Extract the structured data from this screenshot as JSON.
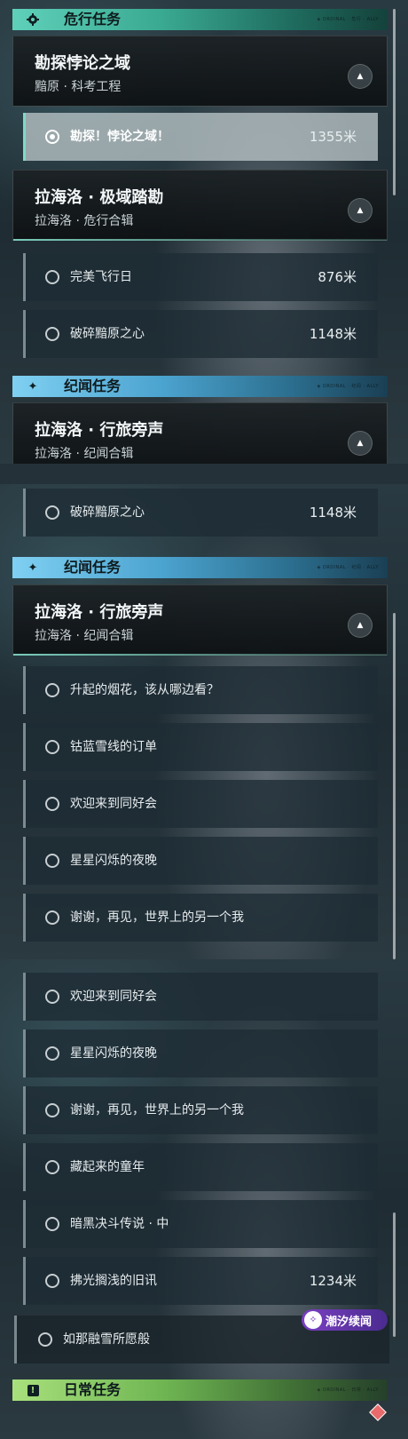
{
  "categories": {
    "danger": {
      "title": "危行任务",
      "icon": "gear-icon",
      "deco": "◈ ORDINAL · 危行 · ALLY"
    },
    "lore": {
      "title": "纪闻任务",
      "icon": "sparkle-icon",
      "deco": "◈ ORDINAL · 纪闻 · ALLY"
    },
    "daily": {
      "title": "日常任务",
      "icon": "exclamation-icon",
      "icon_glyph": "!",
      "deco": "◈ ORDINAL · 日常 · ALLY"
    }
  },
  "groups": {
    "paradox": {
      "title": "勘探悖论之域",
      "subtitle": "黯原 · 科考工程"
    },
    "lahailuo_danger": {
      "title": "拉海洛 · 极域踏勘",
      "subtitle": "拉海洛 · 危行合辑"
    },
    "lahailuo_lore": {
      "title": "拉海洛 · 行旅旁声",
      "subtitle": "拉海洛 · 纪闻合辑"
    }
  },
  "quests": {
    "explore_paradox": {
      "name": "勘探！悖论之域！",
      "distance": "1355米",
      "active": true
    },
    "perfect_flight": {
      "name": "完美飞行日",
      "distance": "876米"
    },
    "shatter_heart": {
      "name": "破碎黯原之心",
      "distance": "1148米"
    },
    "fireworks": {
      "name": "升起的烟花，该从哪边看？"
    },
    "cobalt_order": {
      "name": "钴蓝雪线的订单"
    },
    "welcome_club": {
      "name": "欢迎来到同好会"
    },
    "starry_night": {
      "name": "星星闪烁的夜晚"
    },
    "thanks_goodbye": {
      "name": "谢谢，再见，世界上的另一个我"
    },
    "hidden_childhood": {
      "name": "藏起来的童年"
    },
    "dark_duel": {
      "name": "暗黑决斗传说 · 中"
    },
    "old_news": {
      "name": "拂光搁浅的旧讯",
      "distance": "1234米"
    },
    "melting_snow": {
      "name": "如那融雪所愿般"
    }
  },
  "logo": {
    "text": "潮汐续闻"
  },
  "colors": {
    "danger_accent": "#5fd0b9",
    "lore_accent": "#7fd0f2",
    "daily_accent": "#a8e07c",
    "logo_purple": "#7a3fc2"
  }
}
